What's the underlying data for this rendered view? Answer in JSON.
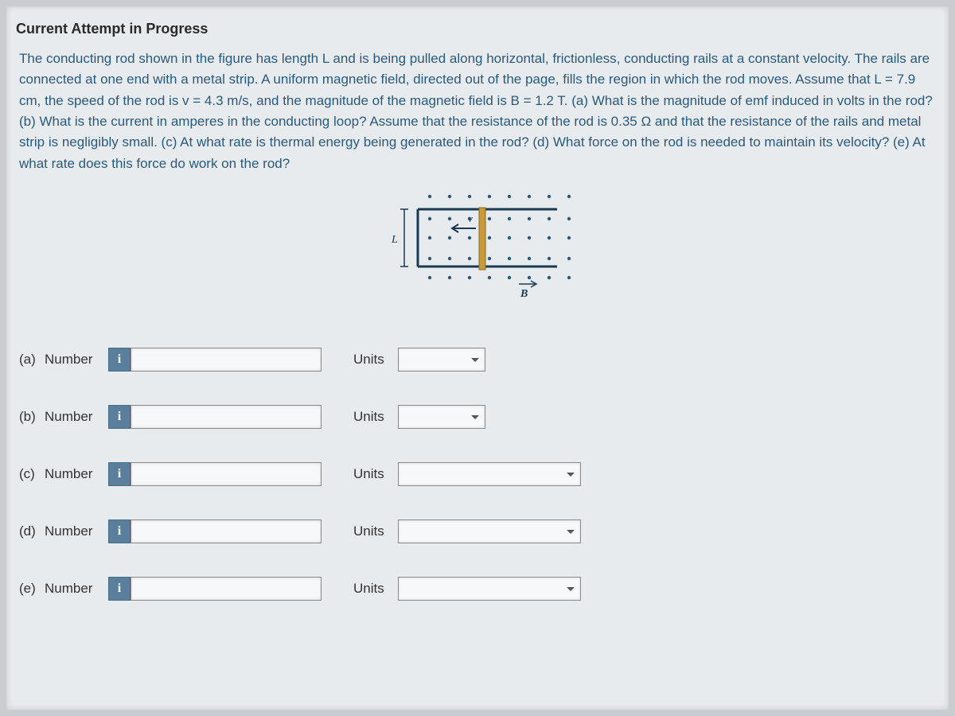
{
  "heading": "Current Attempt in Progress",
  "problem_text": "The conducting rod shown in the figure has length L and is being pulled along horizontal, frictionless, conducting rails at a constant velocity. The rails are connected at one end with a metal strip. A uniform magnetic field, directed out of the page, fills the region in which the rod moves. Assume that L = 7.9 cm, the speed of the rod is v = 4.3 m/s, and the magnitude of the magnetic field is B = 1.2 T. (a) What is the magnitude of emf induced in volts in the rod? (b) What is the current in amperes in the conducting loop? Assume that the resistance of the rod is 0.35 Ω and that the resistance of the rails and metal strip is negligibly small. (c) At what rate is thermal energy being generated in the rod? (d) What force on the rod is needed to maintain its velocity? (e) At what rate does this force do work on the rod?",
  "labels": {
    "number": "Number",
    "units": "Units",
    "info": "i"
  },
  "figure": {
    "L": "L",
    "v": "v",
    "B": "B"
  },
  "parts": {
    "a": {
      "id": "(a)",
      "unit_width": "short"
    },
    "b": {
      "id": "(b)",
      "unit_width": "short"
    },
    "c": {
      "id": "(c)",
      "unit_width": "long"
    },
    "d": {
      "id": "(d)",
      "unit_width": "long"
    },
    "e": {
      "id": "(e)",
      "unit_width": "long"
    }
  }
}
